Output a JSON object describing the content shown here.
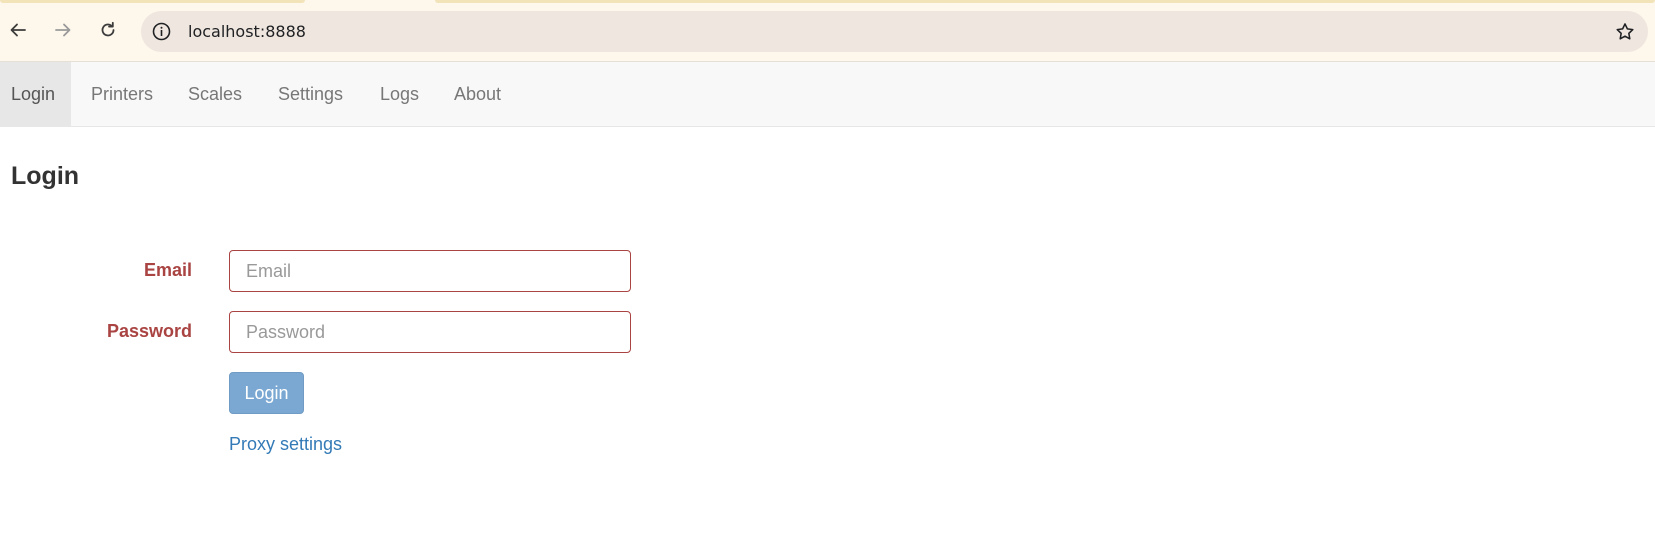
{
  "browser": {
    "url": "localhost:8888",
    "icons": {
      "back": "arrow-left-icon",
      "forward": "arrow-right-icon",
      "reload": "reload-icon",
      "site_info": "info-icon",
      "bookmark": "star-icon"
    }
  },
  "navbar": {
    "items": [
      {
        "label": "Login",
        "active": true
      },
      {
        "label": "Printers",
        "active": false
      },
      {
        "label": "Scales",
        "active": false
      },
      {
        "label": "Settings",
        "active": false
      },
      {
        "label": "Logs",
        "active": false
      },
      {
        "label": "About",
        "active": false
      }
    ]
  },
  "main": {
    "title": "Login",
    "form": {
      "email_label": "Email",
      "email_placeholder": "Email",
      "email_value": "",
      "password_label": "Password",
      "password_placeholder": "Password",
      "password_value": "",
      "submit_label": "Login",
      "proxy_link": "Proxy settings"
    }
  },
  "colors": {
    "error": "#a94442",
    "link": "#337ab7",
    "button": "#7aa8d2",
    "navbar_bg": "#f8f8f8",
    "chrome_bg": "#fdf7ec",
    "omnibox_bg": "#efe7df"
  }
}
